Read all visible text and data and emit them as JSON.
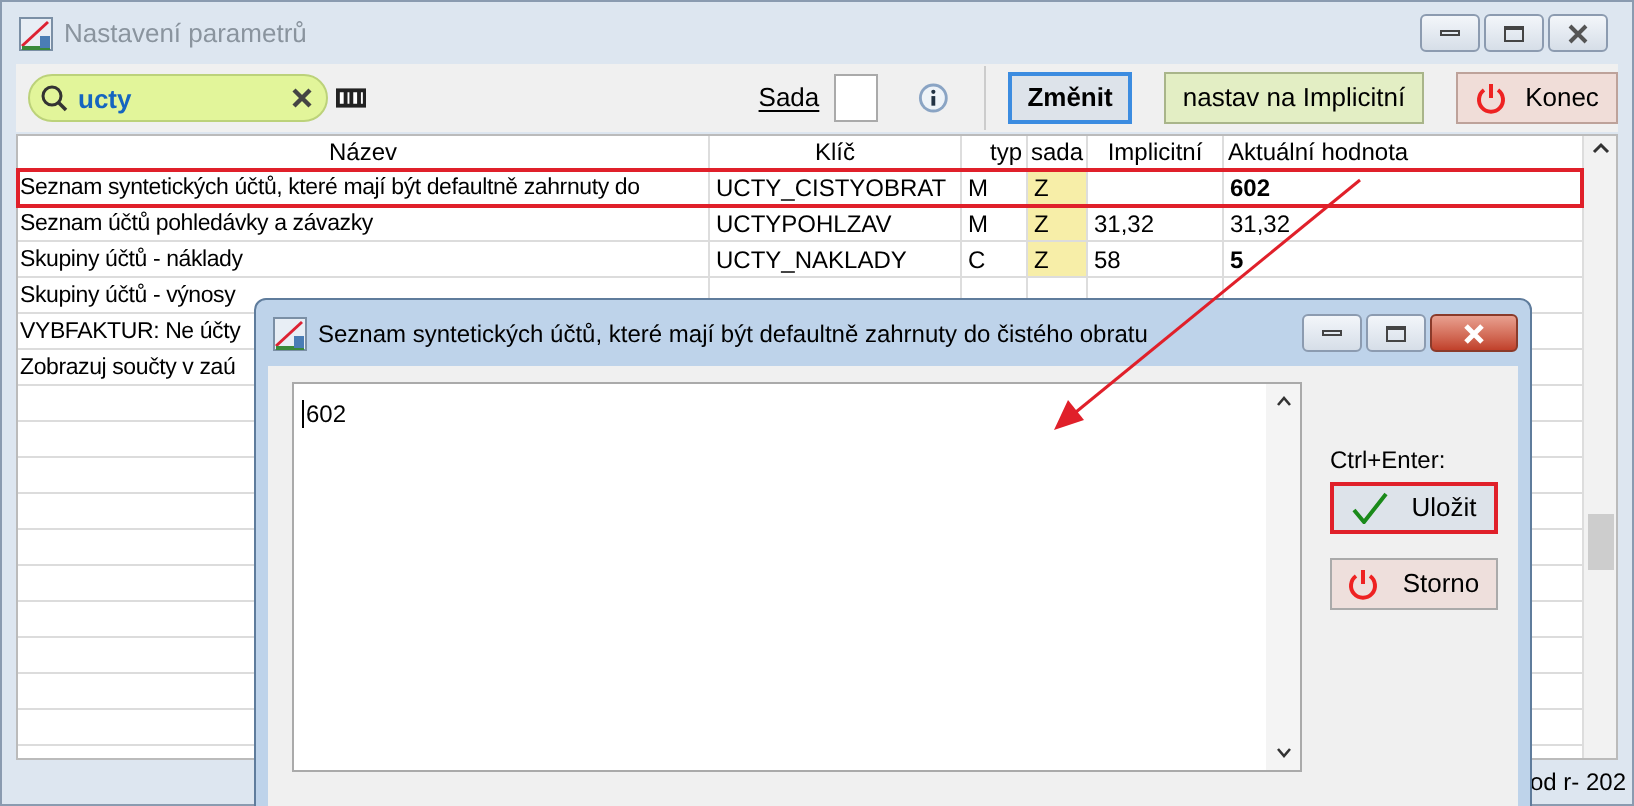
{
  "window": {
    "title": "Nastavení parametrů"
  },
  "toolbar": {
    "search": {
      "value": "ucty"
    },
    "sada_label": "Sada",
    "buttons": [
      {
        "kind": "primary",
        "label": "Změnit"
      },
      {
        "kind": "default",
        "label": "nastav na Implicitní"
      },
      {
        "kind": "exit",
        "label": "Konec"
      }
    ]
  },
  "table": {
    "columns": [
      "Název",
      "Klíč",
      "typ",
      "sada",
      "Implicitní",
      "Aktuální hodnota"
    ],
    "rows": [
      {
        "name": "Seznam syntetických účtů, které mají být defaultně zahrnuty do",
        "key": "UCTY_CISTYOBRAT",
        "type": "M",
        "sada": "Z",
        "default": "",
        "value": "602",
        "modified": true,
        "highlighted": true
      },
      {
        "name": "Seznam účtů pohledávky a závazky",
        "key": "UCTYPOHLZAV",
        "type": "M",
        "sada": "Z",
        "default": "31,32",
        "value": "31,32",
        "modified": false,
        "highlighted": false
      },
      {
        "name": "Skupiny účtů - náklady",
        "key": "UCTY_NAKLADY",
        "type": "C",
        "sada": "Z",
        "default": "58",
        "value": "5",
        "modified": true,
        "highlighted": false
      },
      {
        "name": "Skupiny účtů - výnosy"
      },
      {
        "name": "VYBFAKTUR: Ne účty"
      },
      {
        "name": "Zobrazuj součty v zaú"
      }
    ]
  },
  "status_bar": {
    "text": "od r- 202"
  },
  "dialog": {
    "title": "Seznam syntetických účtů, které mají být defaultně zahrnuty do čistého obratu",
    "value": "602",
    "shortcut_label": "Ctrl+Enter:",
    "buttons": [
      {
        "kind": "save",
        "label": "Uložit",
        "highlighted": true
      },
      {
        "kind": "cancel",
        "label": "Storno",
        "highlighted": false
      }
    ]
  }
}
